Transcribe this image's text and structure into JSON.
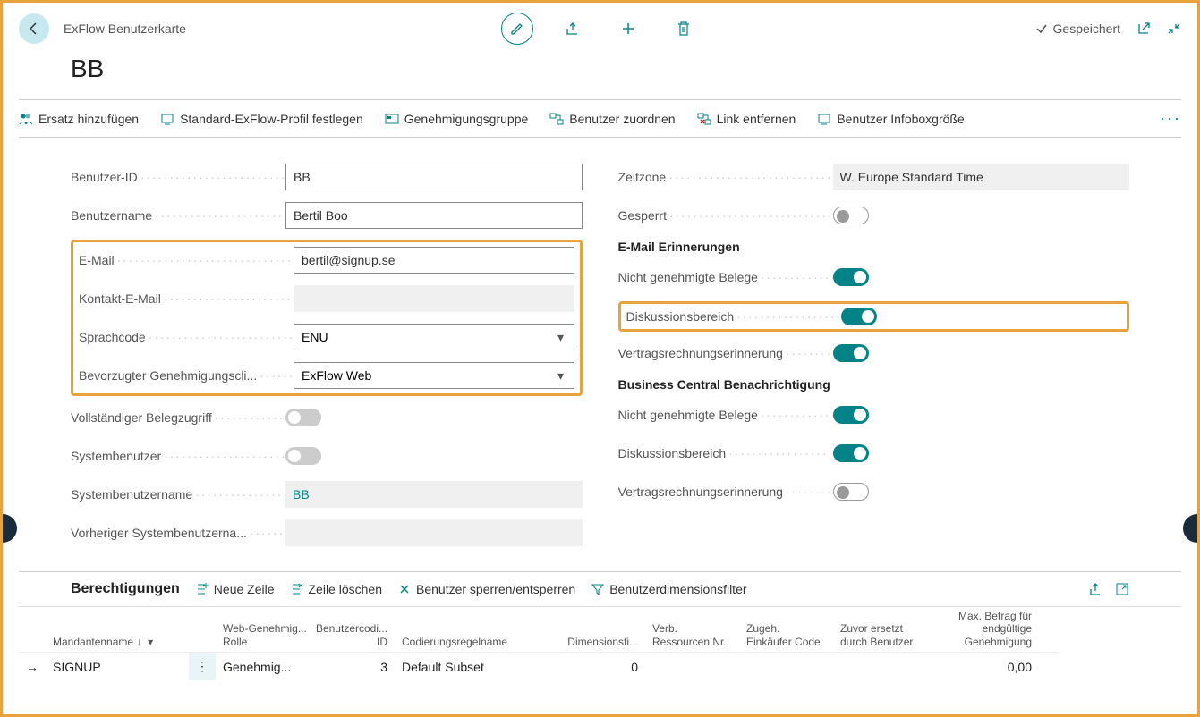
{
  "header": {
    "page_type": "ExFlow Benutzerkarte",
    "title": "BB",
    "saved_label": "Gespeichert"
  },
  "actions": {
    "ersatz": "Ersatz hinzufügen",
    "standard_profil": "Standard-ExFlow-Profil festlegen",
    "genehmigungsgruppe": "Genehmigungsgruppe",
    "benutzer_zuordnen": "Benutzer zuordnen",
    "link_entfernen": "Link entfernen",
    "infoboxgroesse": "Benutzer Infoboxgröße"
  },
  "fields": {
    "benutzer_id": {
      "label": "Benutzer-ID",
      "value": "BB"
    },
    "benutzername": {
      "label": "Benutzername",
      "value": "Bertil Boo"
    },
    "email": {
      "label": "E-Mail",
      "value": "bertil@signup.se"
    },
    "kontakt_email": {
      "label": "Kontakt-E-Mail",
      "value": ""
    },
    "sprachcode": {
      "label": "Sprachcode",
      "value": "ENU"
    },
    "bevorzugter_client": {
      "label": "Bevorzugter Genehmigungscli...",
      "value": "ExFlow Web"
    },
    "voll_belegzugriff": {
      "label": "Vollständiger Belegzugriff"
    },
    "systembenutzer": {
      "label": "Systembenutzer"
    },
    "systembenutzername": {
      "label": "Systembenutzername",
      "value": "BB"
    },
    "vorheriger_sysname": {
      "label": "Vorheriger Systembenutzerna...",
      "value": ""
    },
    "zeitzone": {
      "label": "Zeitzone",
      "value": "W. Europe Standard Time"
    },
    "gesperrt": {
      "label": "Gesperrt"
    }
  },
  "email_reminders": {
    "heading": "E-Mail Erinnerungen",
    "nicht_genehmigt": "Nicht genehmigte Belege",
    "diskussion": "Diskussionsbereich",
    "vertragsrechnung": "Vertragsrechnungserinnerung"
  },
  "bc_notification": {
    "heading": "Business Central Benachrichtigung",
    "nicht_genehmigt": "Nicht genehmigte Belege",
    "diskussion": "Diskussionsbereich",
    "vertragsrechnung": "Vertragsrechnungserinnerung"
  },
  "grid": {
    "title": "Berechtigungen",
    "actions": {
      "neue_zeile": "Neue Zeile",
      "zeile_loeschen": "Zeile löschen",
      "sperren": "Benutzer sperren/entsperren",
      "dimfilter": "Benutzerdimensionsfilter"
    },
    "columns": {
      "mandant": "Mandantenname ↓",
      "webrole": "Web-Genehmig... Rolle",
      "bcid": "Benutzercodi... ID",
      "rulename": "Codierungsregelname",
      "dimfi": "Dimensionsfi...",
      "verb": "Verb. Ressourcen Nr.",
      "ek": "Zugeh. Einkäufer Code",
      "zuvor": "Zuvor ersetzt durch Benutzer",
      "max": "Max. Betrag für endgültige Genehmigung"
    },
    "rows": [
      {
        "mandant": "SIGNUP",
        "webrole": "Genehmig...",
        "bcid": "3",
        "rulename": "Default Subset",
        "dimfi": "0",
        "verb": "",
        "ek": "",
        "zuvor": "",
        "max": "0,00"
      }
    ]
  }
}
